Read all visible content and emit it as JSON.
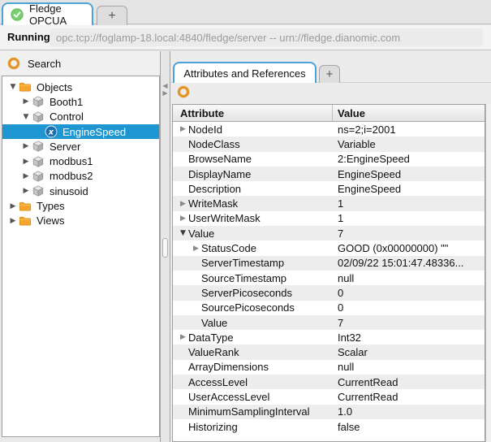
{
  "window": {
    "tab_label": "Fledge OPCUA",
    "tab_status_icon": "check-circle",
    "new_tab_label": "+",
    "status_label": "Running",
    "server_url": "opc.tcp://foglamp-18.local:4840/fledge/server -- urn://fledge.dianomic.com"
  },
  "sidebar": {
    "header_label": "Search",
    "header_icon": "orange-ring",
    "tree": [
      {
        "label": "Objects",
        "icon": "folder",
        "level": 0,
        "expander": "expanded",
        "selected": false
      },
      {
        "label": "Booth1",
        "icon": "cube",
        "level": 1,
        "expander": "collapsed",
        "selected": false
      },
      {
        "label": "Control",
        "icon": "cube",
        "level": 1,
        "expander": "expanded",
        "selected": false
      },
      {
        "label": "EngineSpeed",
        "icon": "variable",
        "level": 2,
        "expander": "none",
        "selected": true
      },
      {
        "label": "Server",
        "icon": "cube",
        "level": 1,
        "expander": "collapsed",
        "selected": false
      },
      {
        "label": "modbus1",
        "icon": "cube",
        "level": 1,
        "expander": "collapsed",
        "selected": false
      },
      {
        "label": "modbus2",
        "icon": "cube",
        "level": 1,
        "expander": "collapsed",
        "selected": false
      },
      {
        "label": "sinusoid",
        "icon": "cube",
        "level": 1,
        "expander": "collapsed",
        "selected": false
      },
      {
        "label": "Types",
        "icon": "folder",
        "level": 0,
        "expander": "collapsed",
        "selected": false
      },
      {
        "label": "Views",
        "icon": "folder",
        "level": 0,
        "expander": "collapsed",
        "selected": false
      }
    ]
  },
  "attributes_panel": {
    "tab_label": "Attributes and References",
    "new_tab_label": "+",
    "toolbar_icon": "orange-ring",
    "table": {
      "columns": [
        "Attribute",
        "Value"
      ],
      "rows": [
        {
          "attribute": "NodeId",
          "value": "ns=2;i=2001",
          "level": 0,
          "expander": "collapsed"
        },
        {
          "attribute": "NodeClass",
          "value": "Variable",
          "level": 0,
          "expander": "none"
        },
        {
          "attribute": "BrowseName",
          "value": "2:EngineSpeed",
          "level": 0,
          "expander": "none"
        },
        {
          "attribute": "DisplayName",
          "value": "EngineSpeed",
          "level": 0,
          "expander": "none"
        },
        {
          "attribute": "Description",
          "value": "EngineSpeed",
          "level": 0,
          "expander": "none"
        },
        {
          "attribute": "WriteMask",
          "value": "1",
          "level": 0,
          "expander": "collapsed"
        },
        {
          "attribute": "UserWriteMask",
          "value": "1",
          "level": 0,
          "expander": "collapsed"
        },
        {
          "attribute": "Value",
          "value": "7",
          "level": 0,
          "expander": "expanded"
        },
        {
          "attribute": "StatusCode",
          "value": "GOOD (0x00000000) \"\"",
          "level": 1,
          "expander": "collapsed"
        },
        {
          "attribute": "ServerTimestamp",
          "value": "02/09/22 15:01:47.48336...",
          "level": 1,
          "expander": "none"
        },
        {
          "attribute": "SourceTimestamp",
          "value": "null",
          "level": 1,
          "expander": "none"
        },
        {
          "attribute": "ServerPicoseconds",
          "value": "0",
          "level": 1,
          "expander": "none"
        },
        {
          "attribute": "SourcePicoseconds",
          "value": "0",
          "level": 1,
          "expander": "none"
        },
        {
          "attribute": "Value",
          "value": "7",
          "level": 1,
          "expander": "none"
        },
        {
          "attribute": "DataType",
          "value": "Int32",
          "level": 0,
          "expander": "collapsed"
        },
        {
          "attribute": "ValueRank",
          "value": "Scalar",
          "level": 0,
          "expander": "none"
        },
        {
          "attribute": "ArrayDimensions",
          "value": "null",
          "level": 0,
          "expander": "none"
        },
        {
          "attribute": "AccessLevel",
          "value": "CurrentRead",
          "level": 0,
          "expander": "none"
        },
        {
          "attribute": "UserAccessLevel",
          "value": "CurrentRead",
          "level": 0,
          "expander": "none"
        },
        {
          "attribute": "MinimumSamplingInterval",
          "value": "1.0",
          "level": 0,
          "expander": "none"
        },
        {
          "attribute": "Historizing",
          "value": "false",
          "level": 0,
          "expander": "none"
        }
      ]
    }
  },
  "colors": {
    "selection_blue": "#1e96d2",
    "tab_border_blue": "#4da2d8",
    "folder_orange": "#f5a52b",
    "ring_orange": "#e89a2e",
    "check_green": "#77cf6f",
    "variable_blue": "#1b6fae",
    "zebra_gray": "#ededed"
  }
}
